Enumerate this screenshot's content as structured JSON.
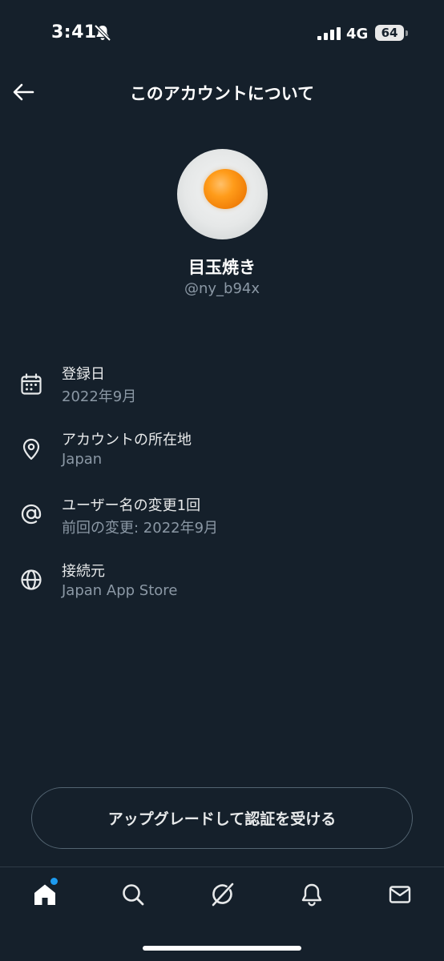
{
  "status_bar": {
    "time": "3:41",
    "network": "4G",
    "battery": "64"
  },
  "header": {
    "title": "このアカウントについて"
  },
  "profile": {
    "display_name": "目玉焼き",
    "handle": "@ny_b94x"
  },
  "info": {
    "joined": {
      "title": "登録日",
      "value": "2022年9月",
      "icon": "calendar-icon"
    },
    "location": {
      "title": "アカウントの所在地",
      "value": "Japan",
      "icon": "location-pin-icon"
    },
    "username_changes": {
      "title": "ユーザー名の変更1回",
      "value": "前回の変更: 2022年9月",
      "icon": "at-sign-icon"
    },
    "connected_via": {
      "title": "接続元",
      "value": "Japan App Store",
      "icon": "globe-icon"
    }
  },
  "upgrade": {
    "label": "アップグレードして認証を受ける"
  },
  "nav": {
    "items": [
      "home-icon",
      "search-icon",
      "grok-icon",
      "bell-icon",
      "mail-icon"
    ],
    "active": "home-icon",
    "accent": "#1d9bf0"
  },
  "colors": {
    "background": "#15202b",
    "primary_text": "#e7e9ea",
    "secondary_text": "#8b98a5",
    "border": "#536471"
  }
}
